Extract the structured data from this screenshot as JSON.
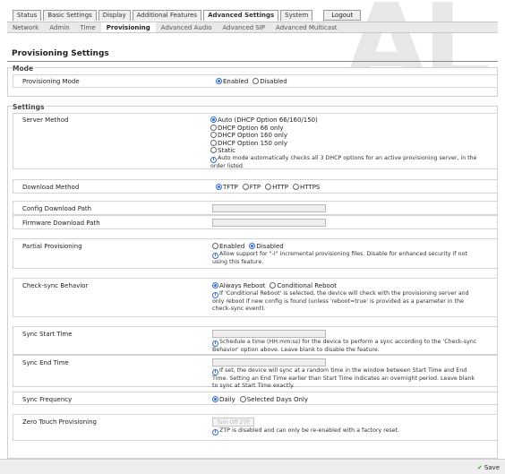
{
  "top_tabs": [
    {
      "label": "Status",
      "active": false
    },
    {
      "label": "Basic Settings",
      "active": false
    },
    {
      "label": "Display",
      "active": false
    },
    {
      "label": "Additional Features",
      "active": false
    },
    {
      "label": "Advanced Settings",
      "active": true
    },
    {
      "label": "System",
      "active": false
    }
  ],
  "logout_label": "Logout",
  "watermark": "AL",
  "sub_tabs": [
    {
      "label": "Network",
      "active": false
    },
    {
      "label": "Admin",
      "active": false
    },
    {
      "label": "Time",
      "active": false
    },
    {
      "label": "Provisioning",
      "active": true
    },
    {
      "label": "Advanced Audio",
      "active": false
    },
    {
      "label": "Advanced SIP",
      "active": false
    },
    {
      "label": "Advanced Multicast",
      "active": false
    }
  ],
  "page_title": "Provisioning Settings",
  "mode": {
    "legend": "Mode",
    "label": "Provisioning Mode",
    "options": [
      "Enabled",
      "Disabled"
    ],
    "selected": "Enabled"
  },
  "settings": {
    "legend": "Settings",
    "server_method": {
      "label": "Server Method",
      "options": [
        "Auto (DHCP Option 66/160/150)",
        "DHCP Option 66 only",
        "DHCP Option 160 only",
        "DHCP Option 150 only",
        "Static"
      ],
      "selected": "Auto (DHCP Option 66/160/150)",
      "hint": "Auto mode automatically checks all 3 DHCP options for an active provisioning server, in the order listed."
    },
    "download_method": {
      "label": "Download Method",
      "options": [
        "TFTP",
        "FTP",
        "HTTP",
        "HTTPS"
      ],
      "selected": "TFTP"
    },
    "config_path": {
      "label": "Config Download Path",
      "value": ""
    },
    "firmware_path": {
      "label": "Firmware Download Path",
      "value": ""
    },
    "partial": {
      "label": "Partial Provisioning",
      "options": [
        "Enabled",
        "Disabled"
      ],
      "selected": "Disabled",
      "hint": "Allow support for \"-i\" incremental provisioning files. Disable for enhanced security if not using this feature."
    },
    "checksync": {
      "label": "Check-sync Behavior",
      "options": [
        "Always Reboot",
        "Conditional Reboot"
      ],
      "selected": "Always Reboot",
      "hint": "If 'Conditional Reboot' is selected, the device will check with the provisioning server and only reboot if new config is found (unless 'reboot=true' is provided as a parameter in the check-sync event)."
    },
    "sync_start": {
      "label": "Sync Start Time",
      "value": "",
      "hint": "Schedule a time (HH:mm:ss) for the device to perform a sync according to the 'Check-sync Behavior' option above. Leave blank to disable the feature."
    },
    "sync_end": {
      "label": "Sync End Time",
      "value": "",
      "hint": "If set, the device will sync at a random time in the window between Start Time and End Time. Setting an End Time earlier than Start Time indicates an overnight period. Leave blank to sync at Start Time exactly."
    },
    "sync_freq": {
      "label": "Sync Frequency",
      "options": [
        "Daily",
        "Selected Days Only"
      ],
      "selected": "Daily"
    },
    "ztp": {
      "label": "Zero Touch Provisioning",
      "button": "Turn Off ZTP",
      "hint": "ZTP is disabled and can only be re-enabled with a factory reset."
    }
  },
  "footer": {
    "save_label": "Save"
  },
  "colors": {
    "accent": "#2d6cd4",
    "save_check": "#3aa23a",
    "watermark": "#e7e7e7"
  }
}
